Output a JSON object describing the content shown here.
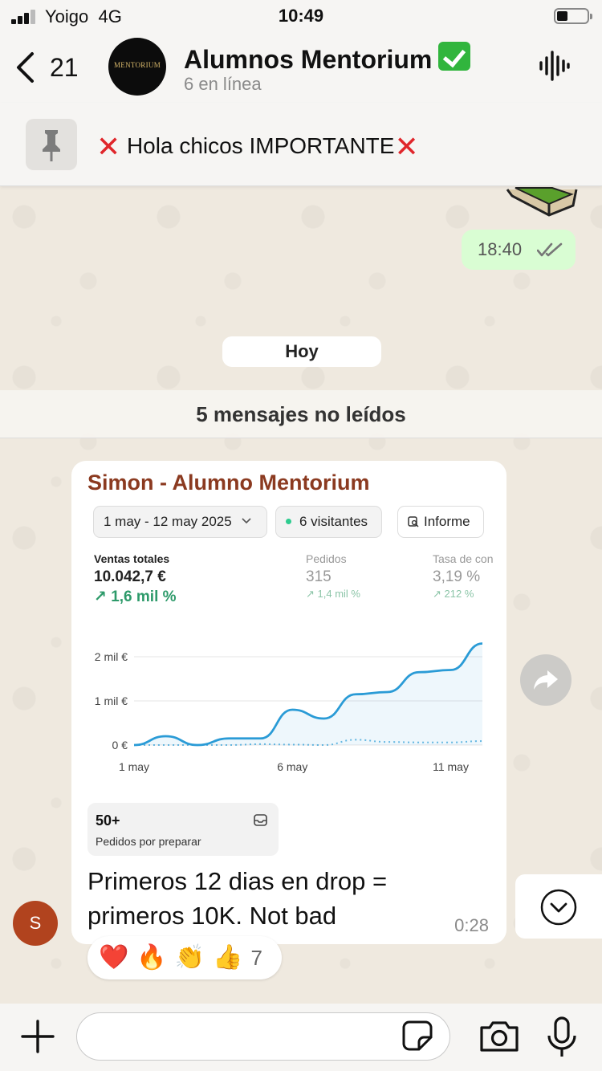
{
  "status_bar": {
    "carrier": "Yoigo",
    "network": "4G",
    "time": "10:49",
    "battery_level": 0.35
  },
  "header": {
    "back_count": "21",
    "avatar_text": "MENTORIUM",
    "title": "Alumnos Mentorium",
    "subtitle": "6 en línea",
    "verified_icon": "check-mark-button-emoji"
  },
  "pinned": {
    "text": "Hola chicos IMPORTANTE",
    "icon": "pin-icon"
  },
  "previous_message": {
    "time": "18:40",
    "status_icon": "double-check-icon"
  },
  "date_separator": "Hoy",
  "unread_banner": "5 mensajes no leídos",
  "message": {
    "sender_name": "Simon - Alumno Mentorium",
    "sender_initial": "S",
    "text": "Primeros 12 dias en drop = primeros 10K. Not bad",
    "time": "0:28",
    "screenshot": {
      "date_range": "1 may - 12 may 2025",
      "visitors": "6 visitantes",
      "report_button": "Informe",
      "kpis": [
        {
          "label": "Ventas totales",
          "value": "10.042,7 €",
          "delta": "1,6 mil %"
        },
        {
          "label": "Pedidos",
          "value": "315",
          "delta": "1,4 mil %"
        },
        {
          "label": "Tasa de con",
          "value": "3,19 %",
          "delta": "212 %"
        }
      ],
      "pending": {
        "count": "50+",
        "label": "Pedidos por preparar"
      }
    }
  },
  "reactions": {
    "emojis": [
      "❤️",
      "🔥",
      "👏",
      "👍"
    ],
    "count": "7"
  },
  "composer": {
    "placeholder": ""
  },
  "colors": {
    "sender": "#8b3a20",
    "outgoing_bubble": "#d9fdd3",
    "chart_line": "#2a9bd6",
    "delta_green": "#2d9a6a"
  },
  "chart_data": {
    "type": "line",
    "x": [
      "1 may",
      "2 may",
      "3 may",
      "4 may",
      "5 may",
      "6 may",
      "7 may",
      "8 may",
      "9 may",
      "10 may",
      "11 may",
      "12 may"
    ],
    "xticks": [
      "1 may",
      "6 may",
      "11 may"
    ],
    "yticks": [
      "0 €",
      "1 mil €",
      "2 mil €"
    ],
    "ylim": [
      0,
      2400
    ],
    "series": [
      {
        "style": "solid",
        "values": [
          0,
          200,
          0,
          150,
          150,
          800,
          600,
          1150,
          1200,
          1650,
          1700,
          2300
        ]
      },
      {
        "style": "dotted",
        "values": [
          0,
          0,
          0,
          0,
          20,
          10,
          0,
          120,
          70,
          60,
          60,
          90
        ]
      }
    ]
  }
}
